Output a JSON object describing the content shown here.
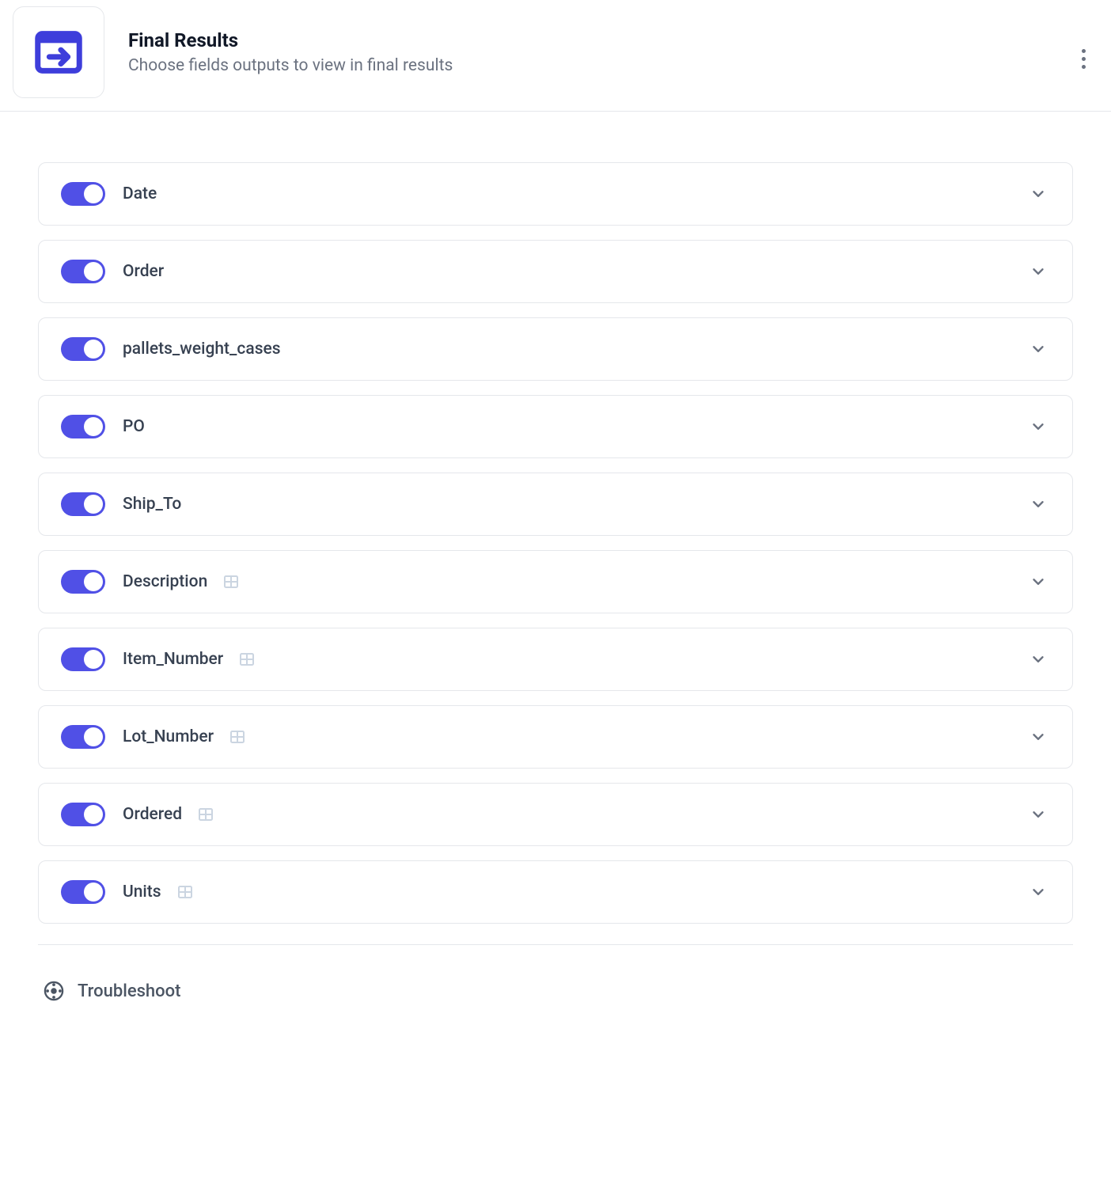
{
  "header": {
    "title": "Final Results",
    "subtitle": "Choose fields outputs to view in final results"
  },
  "fields": [
    {
      "label": "Date",
      "enabled": true,
      "has_table_icon": false
    },
    {
      "label": "Order",
      "enabled": true,
      "has_table_icon": false
    },
    {
      "label": "pallets_weight_cases",
      "enabled": true,
      "has_table_icon": false
    },
    {
      "label": "PO",
      "enabled": true,
      "has_table_icon": false
    },
    {
      "label": "Ship_To",
      "enabled": true,
      "has_table_icon": false
    },
    {
      "label": "Description",
      "enabled": true,
      "has_table_icon": true
    },
    {
      "label": "Item_Number",
      "enabled": true,
      "has_table_icon": true
    },
    {
      "label": "Lot_Number",
      "enabled": true,
      "has_table_icon": true
    },
    {
      "label": "Ordered",
      "enabled": true,
      "has_table_icon": true
    },
    {
      "label": "Units",
      "enabled": true,
      "has_table_icon": true
    }
  ],
  "footer": {
    "troubleshoot_label": "Troubleshoot"
  }
}
